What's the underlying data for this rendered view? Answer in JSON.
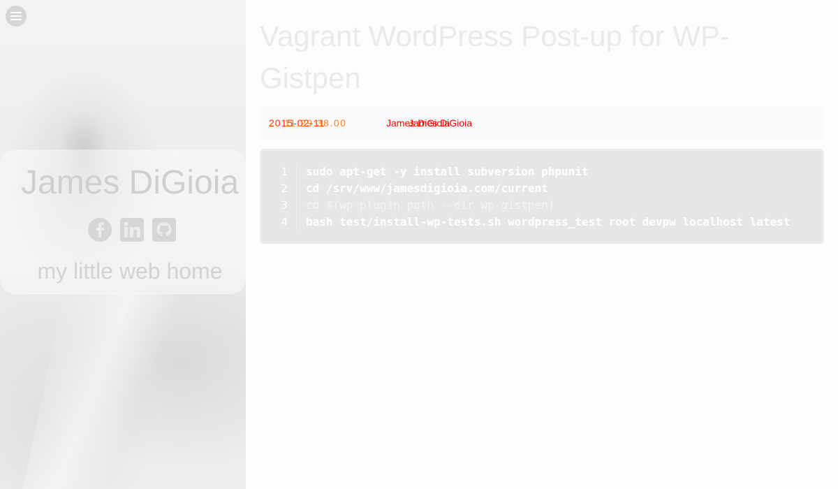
{
  "sidebar": {
    "site_title": "James DiGioia",
    "tagline": "my little web home",
    "social": [
      "facebook-icon",
      "linkedin-icon",
      "github-icon"
    ],
    "menu_icon": "menu-icon"
  },
  "post": {
    "title": "Vagrant WordPress Post-up for WP-Gistpen",
    "meta": {
      "date": "2015-02-11",
      "time": "11:29:38.00",
      "author": "James DiGioia"
    },
    "code_lines": [
      {
        "num": "1",
        "text": "sudo apt-get -y install subversion phpunit"
      },
      {
        "num": "2",
        "text": "cd /srv/www/jamesdigioia.com/current"
      },
      {
        "num": "3",
        "text": "cd $(wp plugin path --dir wp-gistpen)"
      },
      {
        "num": "4",
        "text": "bash test/install-wp-tests.sh wordpress_test root devpw localhost latest"
      }
    ]
  },
  "colors": {
    "meta_text": "#ff0000",
    "code_bg": "#e6e6e6",
    "sidebar_bg": "#ececec"
  }
}
